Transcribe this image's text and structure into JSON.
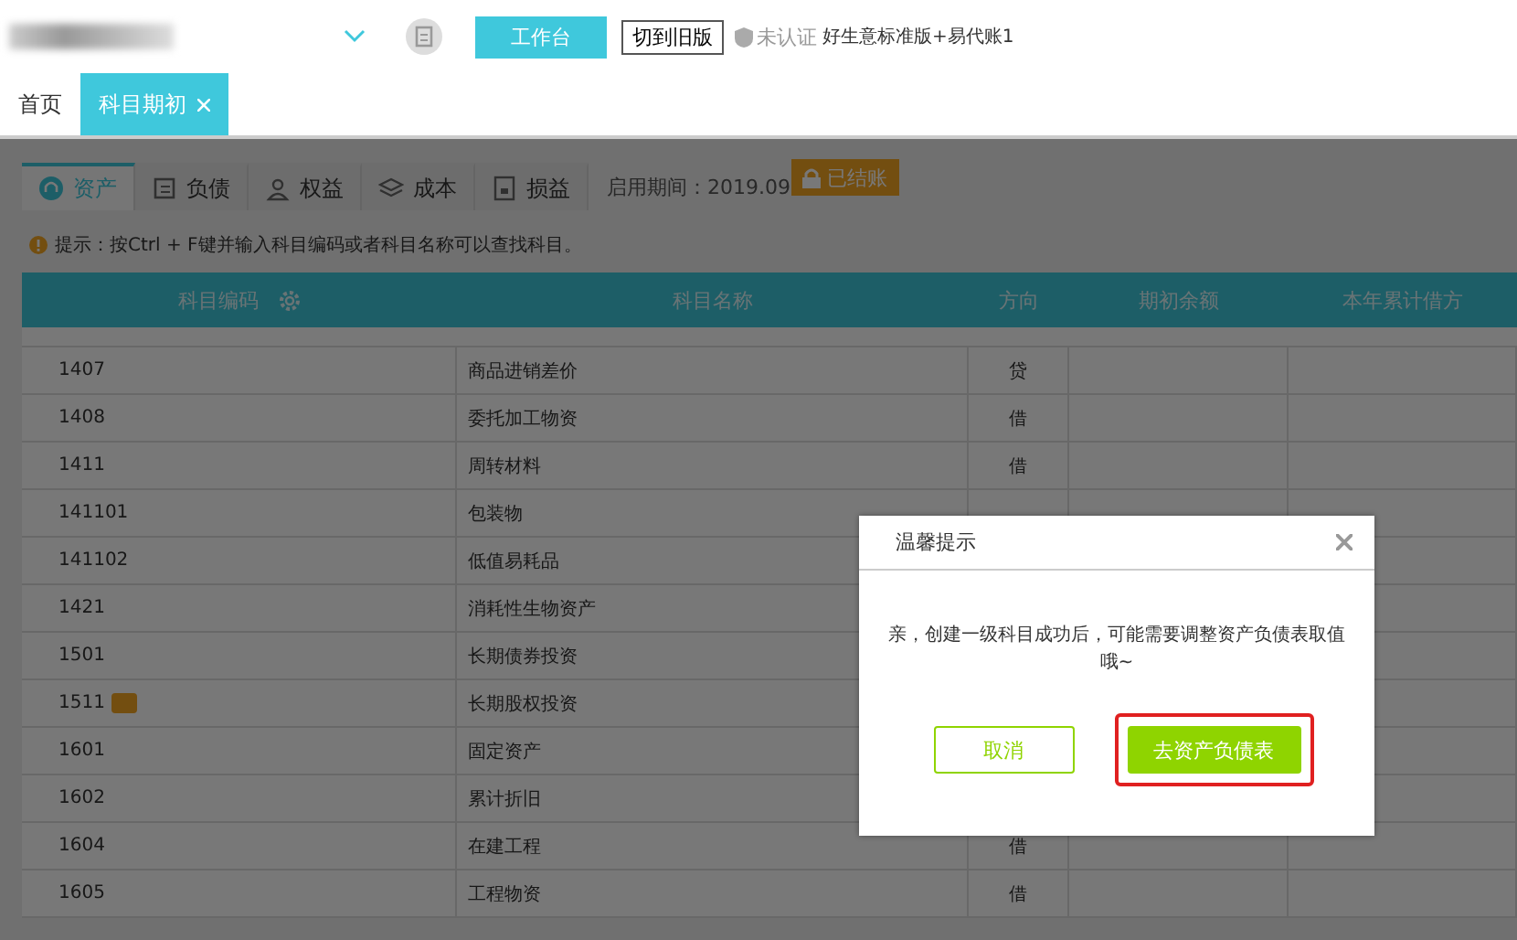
{
  "top_bar": {
    "workbench_button": "工作台",
    "switch_button": "切到旧版",
    "cert_status": "未认证",
    "product": "好生意标准版+易代账1"
  },
  "tabs": [
    {
      "label": "首页",
      "selected": false,
      "closable": false
    },
    {
      "label": "科目期初",
      "selected": true,
      "closable": true
    }
  ],
  "category_tabs": [
    {
      "label": "资产",
      "selected": true
    },
    {
      "label": "负债",
      "selected": false
    },
    {
      "label": "权益",
      "selected": false
    },
    {
      "label": "成本",
      "selected": false
    },
    {
      "label": "损益",
      "selected": false
    }
  ],
  "period": "启用期间：2019.09",
  "closed_badge": "已结账",
  "tip": "提示：按Ctrl + F键并输入科目编码或者科目名称可以查找科目。",
  "table": {
    "columns": [
      "科目编码",
      "科目名称",
      "方向",
      "期初余额",
      "本年累计借方"
    ],
    "rows": [
      {
        "code": "1407",
        "name": "商品进销差价",
        "direction": "贷",
        "flagged": false
      },
      {
        "code": "1408",
        "name": "委托加工物资",
        "direction": "借",
        "flagged": false
      },
      {
        "code": "1411",
        "name": "周转材料",
        "direction": "借",
        "flagged": false
      },
      {
        "code": "141101",
        "name": "包装物",
        "flagged": false
      },
      {
        "code": "141102",
        "name": "低值易耗品",
        "flagged": false
      },
      {
        "code": "1421",
        "name": "消耗性生物资产",
        "flagged": false
      },
      {
        "code": "1501",
        "name": "长期债券投资",
        "flagged": false
      },
      {
        "code": "1511",
        "name": "长期股权投资",
        "flagged": true
      },
      {
        "code": "1601",
        "name": "固定资产",
        "flagged": false
      },
      {
        "code": "1602",
        "name": "累计折旧",
        "flagged": false
      },
      {
        "code": "1604",
        "name": "在建工程",
        "direction": "借",
        "flagged": false
      },
      {
        "code": "1605",
        "name": "工程物资",
        "direction": "借",
        "flagged": false
      }
    ]
  },
  "dialog": {
    "title": "温馨提示",
    "message": "亲，创建一级科目成功后，可能需要调整资产负债表取值哦~",
    "buttons": [
      {
        "label": "取消",
        "kind": "secondary",
        "highlighted": false
      },
      {
        "label": "去资产负债表",
        "kind": "primary",
        "highlighted": true
      }
    ]
  }
}
